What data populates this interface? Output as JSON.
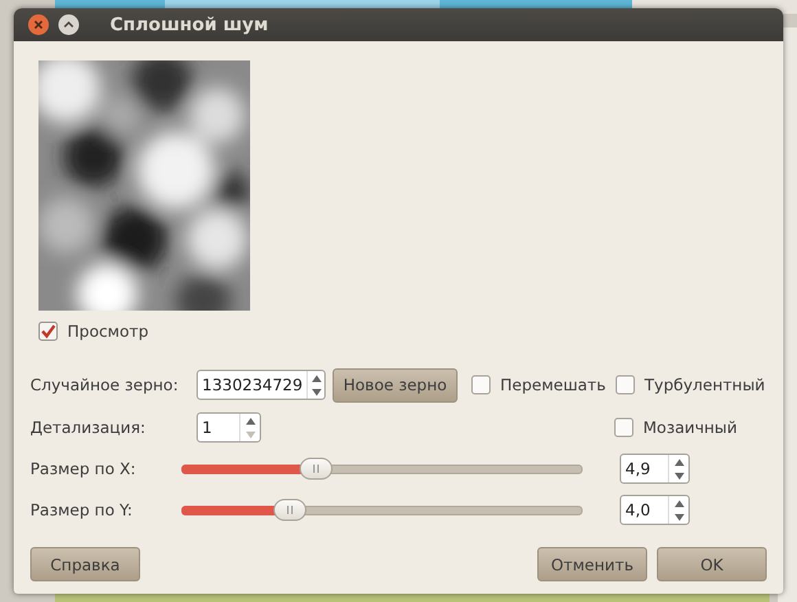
{
  "window": {
    "title": "Сплошной шум"
  },
  "preview": {
    "label": "Просмотр",
    "checked": true
  },
  "seed": {
    "label": "Случайное зерно:",
    "value": "1330234729",
    "button": "Новое зерно"
  },
  "options": [
    {
      "label": "Перемешать",
      "checked": false
    },
    {
      "label": "Турбулентный",
      "checked": false
    },
    {
      "label": "Мозаичный",
      "checked": false
    }
  ],
  "detail": {
    "label": "Детализация:",
    "value": "1",
    "down_disabled": true
  },
  "sizes": [
    {
      "label": "Размер по X:",
      "level": 0.32,
      "value": "4,9"
    },
    {
      "label": "Размер по Y:",
      "level": 0.25,
      "value": "4,0"
    }
  ],
  "buttons": [
    {
      "label": "Справка",
      "kind": "help"
    },
    {
      "label": "Отменить",
      "kind": "action"
    },
    {
      "label": "OK",
      "kind": "action"
    }
  ]
}
